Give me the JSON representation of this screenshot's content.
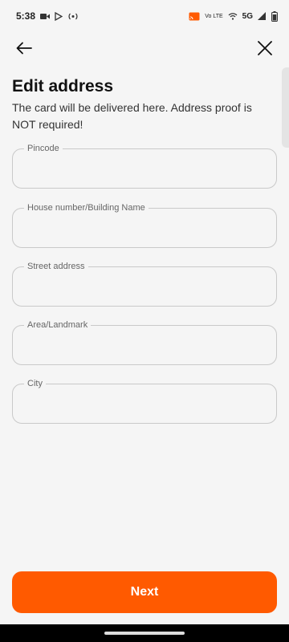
{
  "status_bar": {
    "time": "5:38",
    "network": "5G",
    "volte": "Vo LTE",
    "left_icons": [
      "video-camera-icon",
      "play-store-icon",
      "hotspot-icon"
    ],
    "right_icons": [
      "cast-icon",
      "volte-icon",
      "wifi-calling-icon",
      "signal-icon",
      "battery-icon"
    ]
  },
  "nav": {
    "back_icon": "arrow-left-icon",
    "close_icon": "close-icon"
  },
  "header": {
    "title": "Edit address",
    "subtitle": "The card will be delivered here. Address proof is NOT required!"
  },
  "form": {
    "fields": [
      {
        "label": "Pincode",
        "value": ""
      },
      {
        "label": "House number/Building Name",
        "value": ""
      },
      {
        "label": "Street address",
        "value": ""
      },
      {
        "label": "Area/Landmark",
        "value": ""
      },
      {
        "label": "City",
        "value": ""
      }
    ]
  },
  "actions": {
    "next_label": "Next"
  },
  "colors": {
    "accent": "#ff5a00",
    "field_border": "#c9c9c9",
    "background": "#f5f5f5"
  }
}
